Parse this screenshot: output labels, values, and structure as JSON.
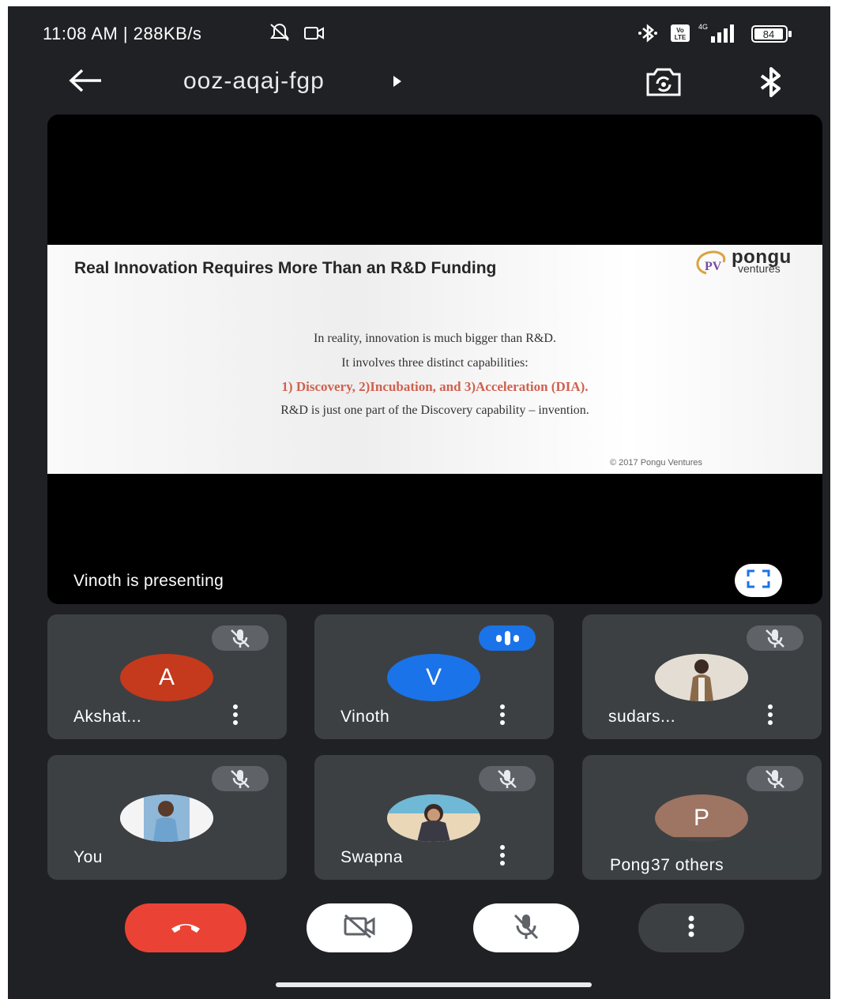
{
  "status_bar": {
    "time": "11:08 AM | 288KB/s",
    "battery": "84",
    "icons": [
      "mute-notification-icon",
      "screen-record-icon",
      "bluetooth-icon",
      "volte-icon",
      "signal-4g-icon",
      "battery-icon"
    ]
  },
  "top_bar": {
    "meeting_code": "ooz-aqaj-fgp",
    "icons": [
      "back-arrow-icon",
      "caret-right-icon",
      "switch-camera-icon",
      "bluetooth-icon"
    ]
  },
  "presentation": {
    "slide": {
      "title": "Real Innovation Requires More Than an R&D Funding",
      "logo_name": "pongu",
      "logo_sub": "ventures",
      "logo_mark": "PV",
      "lines": [
        "In reality, innovation is much bigger than R&D.",
        "It involves three distinct capabilities:",
        "1) Discovery, 2)Incubation, and 3)Acceleration (DIA).",
        "R&D is just one part of the Discovery capability – invention."
      ],
      "copyright": "© 2017 Pongu Ventures",
      "highlight_color": "#d0604e"
    },
    "presenting_label": "Vinoth is presenting"
  },
  "participants": [
    {
      "name": "Akshat...",
      "initial": "A",
      "avatar_color": "#c5391c",
      "status": "muted"
    },
    {
      "name": "Vinoth",
      "initial": "V",
      "avatar_color": "#1a73e8",
      "status": "speaking"
    },
    {
      "name": "sudars...",
      "initial": "",
      "avatar_color": "#d9d2c8",
      "status": "muted"
    },
    {
      "name": "You",
      "initial": "",
      "avatar_color": "#cfe3f5",
      "status": "muted"
    },
    {
      "name": "Swapna",
      "initial": "",
      "avatar_color": "#6fb8d6",
      "status": "muted"
    },
    {
      "name": "Pong",
      "initial": "P",
      "avatar_color": "#9e7462",
      "status": "muted",
      "others_label": "37 others"
    }
  ],
  "controls": {
    "icons": [
      "end-call-icon",
      "camera-off-icon",
      "mic-off-icon",
      "more-vert-icon"
    ],
    "end_call_color": "#ea4335"
  }
}
